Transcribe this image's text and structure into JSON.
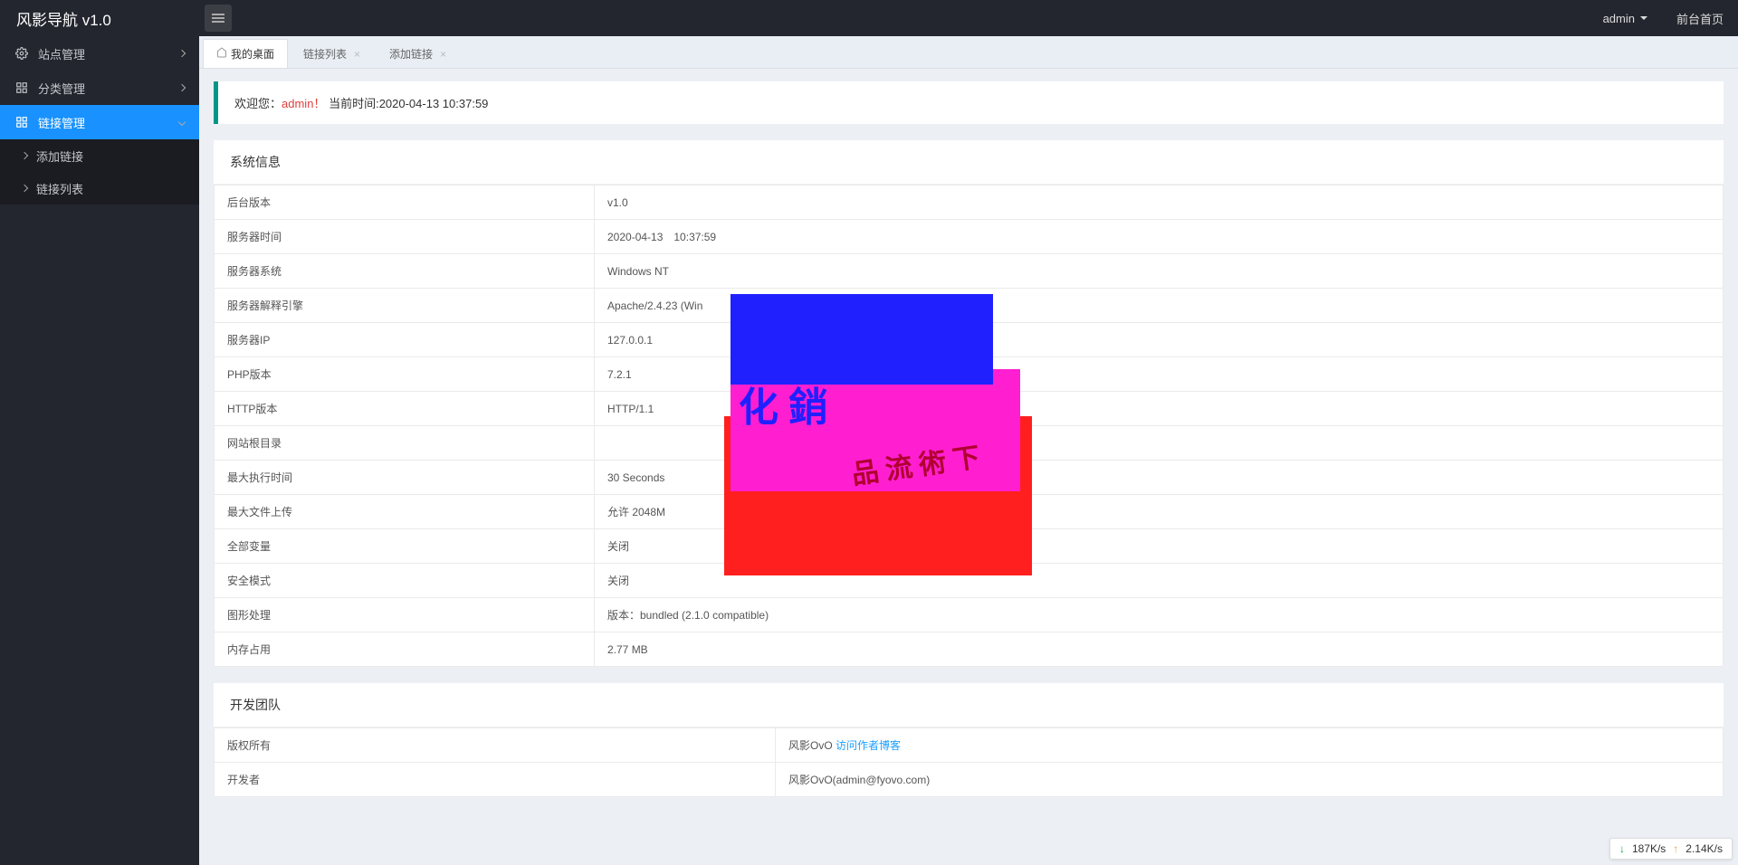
{
  "header": {
    "logo": "风影导航 v1.0",
    "user": "admin",
    "front_link": "前台首页"
  },
  "sidebar": {
    "items": [
      {
        "label": "站点管理",
        "open": false
      },
      {
        "label": "分类管理",
        "open": false
      },
      {
        "label": "链接管理",
        "open": true,
        "active": true,
        "children": [
          {
            "label": "添加链接"
          },
          {
            "label": "链接列表"
          }
        ]
      }
    ]
  },
  "tabs": [
    {
      "label": "我的桌面",
      "closable": false,
      "active": true
    },
    {
      "label": "链接列表",
      "closable": true,
      "active": false
    },
    {
      "label": "添加链接",
      "closable": true,
      "active": false
    }
  ],
  "welcome": {
    "prefix": "欢迎您：",
    "user": "admin！",
    "time_prefix": "当前时间:",
    "time": "2020-04-13 10:37:59"
  },
  "system_info": {
    "title": "系统信息",
    "rows": [
      {
        "label": "后台版本",
        "value": "v1.0"
      },
      {
        "label": "服务器时间",
        "value": "2020-04-13　10:37:59"
      },
      {
        "label": "服务器系统",
        "value": "Windows NT"
      },
      {
        "label": "服务器解释引擎",
        "value": "Apache/2.4.23 (Win"
      },
      {
        "label": "服务器IP",
        "value": "127.0.0.1"
      },
      {
        "label": "PHP版本",
        "value": "7.2.1"
      },
      {
        "label": "HTTP版本",
        "value": "HTTP/1.1"
      },
      {
        "label": "网站根目录",
        "value": ""
      },
      {
        "label": "最大执行时间",
        "value": "30 Seconds"
      },
      {
        "label": "最大文件上传",
        "value": "允许 2048M"
      },
      {
        "label": "全部变量",
        "value": "关闭"
      },
      {
        "label": "安全模式",
        "value": "关闭"
      },
      {
        "label": "图形处理",
        "value": "版本：bundled (2.1.0 compatible)"
      },
      {
        "label": "内存占用",
        "value": "2.77 MB"
      }
    ]
  },
  "dev_team": {
    "title": "开发团队",
    "rows": [
      {
        "label": "版权所有",
        "value_prefix": "风影OvO ",
        "link_text": "访问作者博客"
      },
      {
        "label": "开发者",
        "value": "风影OvO(admin@fyovo.com)"
      }
    ]
  },
  "network": {
    "down": "187K/s",
    "up": "2.14K/s"
  }
}
